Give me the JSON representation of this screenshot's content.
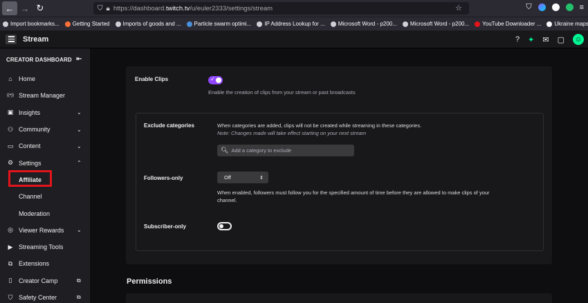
{
  "browser": {
    "url_prefix": "https://dashboard.",
    "url_host": "twitch.tv",
    "url_path": "/u/euler2333/settings/stream",
    "bookmarks": [
      {
        "label": "Import bookmarks...",
        "color": "#cfcfd8"
      },
      {
        "label": "Getting Started",
        "color": "#ff7139"
      },
      {
        "label": "Imports of goods and ...",
        "color": "#cfcfd8"
      },
      {
        "label": "Particle swarm optimi...",
        "color": "#4a90d9"
      },
      {
        "label": "IP Address Lookup for ...",
        "color": "#cfcfd8"
      },
      {
        "label": "Microsoft Word - p200...",
        "color": "#cfcfd8"
      },
      {
        "label": "Microsoft Word - p200...",
        "color": "#cfcfd8"
      },
      {
        "label": "YouTube Downloader ...",
        "color": "#e3141b"
      },
      {
        "label": "Ukraine maps: Trackin...",
        "color": "#fbfbfe"
      }
    ]
  },
  "topnav": {
    "title": "Stream"
  },
  "sidebar": {
    "header": "CREATOR DASHBOARD",
    "items": [
      {
        "label": "Home",
        "icon": "home-icon",
        "glyph": "⌂"
      },
      {
        "label": "Stream Manager",
        "icon": "broadcast-icon",
        "glyph": "((•))"
      },
      {
        "label": "Insights",
        "icon": "insights-icon",
        "glyph": "▣",
        "chevron": "⌄"
      },
      {
        "label": "Community",
        "icon": "community-icon",
        "glyph": "⚇",
        "chevron": "⌄"
      },
      {
        "label": "Content",
        "icon": "content-icon",
        "glyph": "▭",
        "chevron": "⌄"
      },
      {
        "label": "Settings",
        "icon": "gear-icon",
        "glyph": "⚙",
        "chevron": "⌃"
      },
      {
        "label": "Affiliate",
        "sub": true,
        "selected": true
      },
      {
        "label": "Channel",
        "sub": true
      },
      {
        "label": "Moderation",
        "sub": true
      },
      {
        "label": "Viewer Rewards",
        "icon": "rewards-icon",
        "glyph": "◎",
        "chevron": "⌄"
      },
      {
        "label": "Streaming Tools",
        "icon": "camera-icon",
        "glyph": "▶"
      },
      {
        "label": "Extensions",
        "icon": "extensions-icon",
        "glyph": "⧉"
      },
      {
        "label": "Creator Camp",
        "icon": "book-icon",
        "glyph": "▯",
        "chevron": "⧉"
      },
      {
        "label": "Safety Center",
        "icon": "shield-icon",
        "glyph": "⛉",
        "chevron": "⧉"
      }
    ]
  },
  "clips": {
    "enable_label": "Enable Clips",
    "enable_desc": "Enable the creation of clips from your stream or past broadcasts",
    "enable_on": true,
    "exclude_label": "Exclude categories",
    "exclude_desc": "When categories are added, clips will not be created while streaming in these categories.",
    "exclude_note": "Note: Changes made will take effect starting on your next stream",
    "search_placeholder": "Add a category to exclude",
    "followers_label": "Followers-only",
    "followers_value": "Off",
    "followers_desc_1": "When enabled, followers must follow you for the specified amount of time before they are allowed to make clips of your",
    "followers_desc_2": "channel.",
    "subscriber_label": "Subscriber-only",
    "subscriber_on": false
  },
  "permissions_title": "Permissions",
  "colors": {
    "accent": "#9147ff",
    "highlight_box": "#e3141b"
  }
}
